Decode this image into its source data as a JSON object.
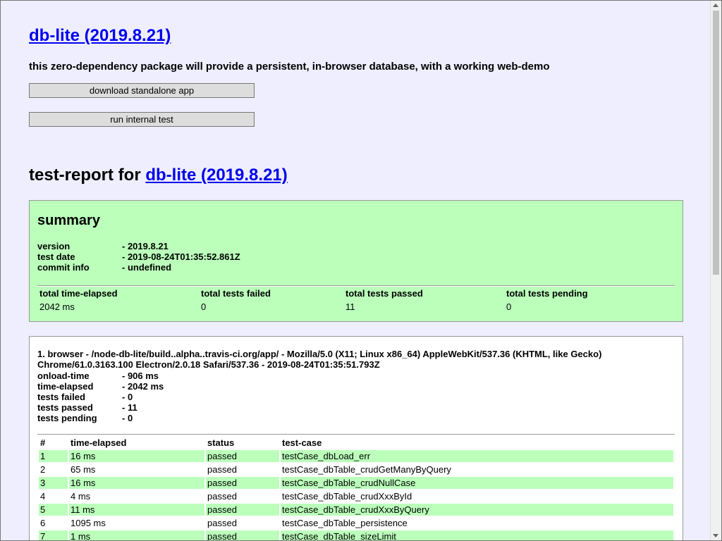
{
  "header": {
    "title_link": "db-lite (2019.8.21)",
    "tagline": "this zero-dependency package will provide a persistent, in-browser database, with a working web-demo",
    "buttons": {
      "download": "download standalone app",
      "run_test": "run internal test"
    }
  },
  "report": {
    "heading_prefix": "test-report for ",
    "heading_link": "db-lite (2019.8.21)",
    "summary": {
      "title": "summary",
      "rows": [
        {
          "key": "version",
          "value": "- 2019.8.21"
        },
        {
          "key": "test date",
          "value": "- 2019-08-24T01:35:52.861Z"
        },
        {
          "key": "commit info",
          "value": "- undefined"
        }
      ],
      "totals": {
        "headers": [
          "total time-elapsed",
          "total tests failed",
          "total tests passed",
          "total tests pending"
        ],
        "values": [
          "2042 ms",
          "0",
          "11",
          "0"
        ]
      }
    },
    "browser": {
      "title": "1. browser - /node-db-lite/build..alpha..travis-ci.org/app/ - Mozilla/5.0 (X11; Linux x86_64) AppleWebKit/537.36 (KHTML, like Gecko) Chrome/61.0.3163.100 Electron/2.0.18 Safari/537.36 - 2019-08-24T01:35:51.793Z",
      "stats": [
        {
          "key": "onload-time",
          "value": "- 906 ms"
        },
        {
          "key": "time-elapsed",
          "value": "- 2042 ms"
        },
        {
          "key": "tests failed",
          "value": "- 0"
        },
        {
          "key": "tests passed",
          "value": "- 11"
        },
        {
          "key": "tests pending",
          "value": "- 0"
        }
      ],
      "table": {
        "headers": [
          "#",
          "time-elapsed",
          "status",
          "test-case"
        ],
        "rows": [
          [
            "1",
            "16 ms",
            "passed",
            "testCase_dbLoad_err"
          ],
          [
            "2",
            "65 ms",
            "passed",
            "testCase_dbTable_crudGetManyByQuery"
          ],
          [
            "3",
            "16 ms",
            "passed",
            "testCase_dbTable_crudNullCase"
          ],
          [
            "4",
            "4 ms",
            "passed",
            "testCase_dbTable_crudXxxById"
          ],
          [
            "5",
            "11 ms",
            "passed",
            "testCase_dbTable_crudXxxByQuery"
          ],
          [
            "6",
            "1095 ms",
            "passed",
            "testCase_dbTable_persistence"
          ],
          [
            "7",
            "1 ms",
            "passed",
            "testCase_dbTable_sizeLimit"
          ]
        ]
      }
    }
  },
  "colors": {
    "page_bg": "#eeeeff",
    "summary_bg": "#bbffbb",
    "row_highlight": "#bbffbb",
    "link": "#0000ee"
  }
}
